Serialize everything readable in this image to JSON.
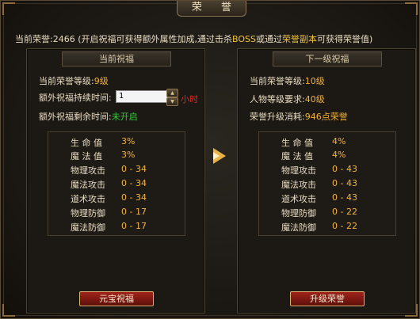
{
  "window": {
    "title": "荣 誉"
  },
  "top": {
    "prefix": "当前荣誉:2466 (开启祝福可获得额外属性加成,通过击杀",
    "boss": "BOSS",
    "mid": "或通过",
    "dungeon": "荣誉副本",
    "suffix": "可获得荣誉值)"
  },
  "left_panel": {
    "header": "当前祝福",
    "level_label": "当前荣誉等级:",
    "level_value": "9级",
    "duration_label": "额外祝福持续时间:",
    "duration_input": "1",
    "duration_unit": "小时",
    "remaining_label": "额外祝福剩余时间:",
    "remaining_value": "未开启",
    "stats": [
      {
        "name": "生 命 值",
        "value": "3%"
      },
      {
        "name": "魔 法 值",
        "value": "3%"
      },
      {
        "name": "物理攻击",
        "value": "0 - 34"
      },
      {
        "name": "魔法攻击",
        "value": "0 - 34"
      },
      {
        "name": "道术攻击",
        "value": "0 - 34"
      },
      {
        "name": "物理防御",
        "value": "0 - 17"
      },
      {
        "name": "魔法防御",
        "value": "0 - 17"
      }
    ],
    "button": "元宝祝福"
  },
  "right_panel": {
    "header": "下一级祝福",
    "level_label": "当前荣誉等级:",
    "level_value": "10级",
    "req_label": "人物等级要求:",
    "req_value": "40级",
    "cost_label": "荣誉升级消耗:",
    "cost_value": "946点荣誉",
    "stats": [
      {
        "name": "生 命 值",
        "value": "4%"
      },
      {
        "name": "魔 法 值",
        "value": "4%"
      },
      {
        "name": "物理攻击",
        "value": "0 - 43"
      },
      {
        "name": "魔法攻击",
        "value": "0 - 43"
      },
      {
        "name": "道术攻击",
        "value": "0 - 43"
      },
      {
        "name": "物理防御",
        "value": "0 - 22"
      },
      {
        "name": "魔法防御",
        "value": "0 - 22"
      }
    ],
    "button": "升级荣誉"
  },
  "colors": {
    "gold": "#f2c43c",
    "orange": "#f2b23c",
    "green": "#36c63a",
    "red": "#e8281e",
    "button_red": "#a0241c"
  },
  "icons": {
    "arrow": "arrow-right-icon",
    "spin_up": "triangle-up-icon",
    "spin_down": "triangle-down-icon"
  }
}
